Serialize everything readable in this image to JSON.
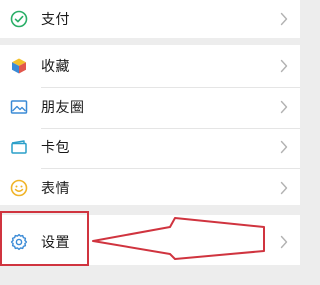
{
  "groups": {
    "pay": {
      "items": [
        {
          "label": "支付",
          "icon": "wechat-pay-icon"
        }
      ]
    },
    "main": {
      "items": [
        {
          "label": "收藏",
          "icon": "favorites-cube-icon"
        },
        {
          "label": "朋友圈",
          "icon": "moments-photo-icon"
        },
        {
          "label": "卡包",
          "icon": "card-wallet-icon"
        },
        {
          "label": "表情",
          "icon": "emoji-smiley-icon"
        }
      ]
    },
    "settings": {
      "items": [
        {
          "label": "设置",
          "icon": "gear-icon"
        }
      ]
    }
  },
  "colors": {
    "background": "#ededed",
    "row_background": "#ffffff",
    "annotation_red": "#d0343f",
    "chevron": "#b2b2b2"
  }
}
